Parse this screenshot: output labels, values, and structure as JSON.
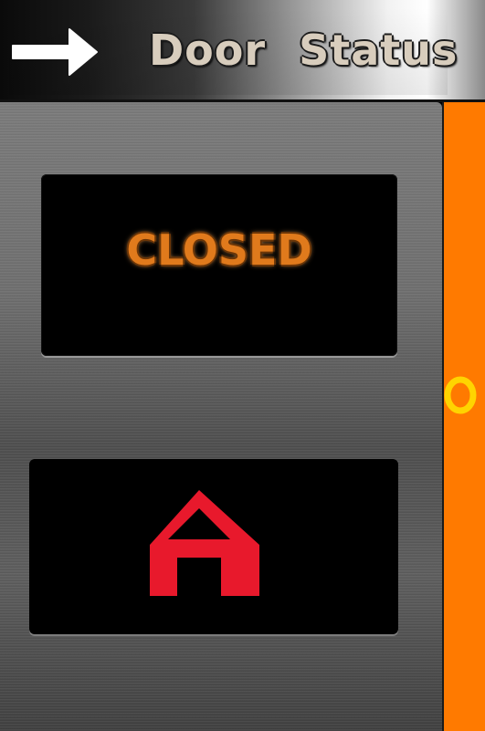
{
  "header": {
    "title_word_1": "Door",
    "title_word_2": "Status",
    "back_icon": "right-arrow-icon"
  },
  "status": {
    "label": "CLOSED",
    "color": "#e07a1c"
  },
  "home_button": {
    "icon": "home-icon",
    "color": "#e8192c"
  },
  "side_panel": {
    "color": "#ff7a00",
    "ring_color": "#ffd400"
  }
}
